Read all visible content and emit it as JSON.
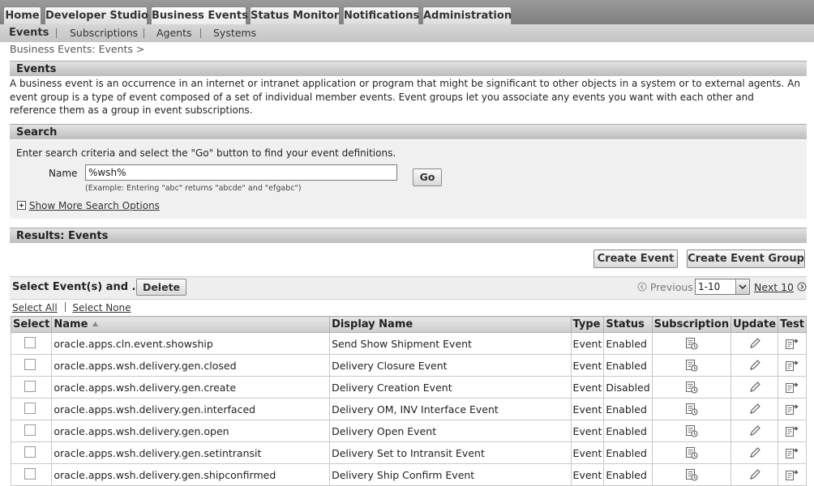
{
  "tabs": [
    {
      "label": "Home"
    },
    {
      "label": "Developer Studio"
    },
    {
      "label": "Business Events"
    },
    {
      "label": "Status Monitor"
    },
    {
      "label": "Notifications"
    },
    {
      "label": "Administration"
    }
  ],
  "subnav": [
    {
      "label": "Events"
    },
    {
      "label": "Subscriptions"
    },
    {
      "label": "Agents"
    },
    {
      "label": "Systems"
    }
  ],
  "breadcrumb": "Business Events: Events  >",
  "events_section": {
    "title": "Events",
    "description": "A business event is an occurrence in an internet or intranet application or program that might be significant to other objects in a system or to external agents. An event group is a type of event composed of a set of individual member events. Event groups let you associate any events you want with each other and reference them as a group in event subscriptions."
  },
  "search": {
    "title": "Search",
    "instructions": "Enter search criteria and select the \"Go\" button to find your event definitions.",
    "name_label": "Name",
    "name_value": "%wsh%",
    "example": "(Example: Entering \"abc\" returns \"abcde\" and \"efgabc\")",
    "go_label": "Go",
    "more_options_label": "Show More Search Options"
  },
  "results": {
    "title": "Results: Events",
    "create_event_label": "Create Event",
    "create_group_label": "Create Event Group",
    "select_label": "Select Event(s) and ...",
    "delete_label": "Delete",
    "previous_label": "Previous",
    "range_value": "1-10",
    "next_label": "Next 10",
    "select_all_label": "Select All",
    "select_none_label": "Select None",
    "columns": {
      "select": "Select",
      "name": "Name",
      "display_name": "Display Name",
      "type": "Type",
      "status": "Status",
      "subscription": "Subscription",
      "update": "Update",
      "test": "Test"
    },
    "rows": [
      {
        "name": "oracle.apps.cln.event.showship",
        "display_name": "Send Show Shipment Event",
        "type": "Event",
        "status": "Enabled"
      },
      {
        "name": "oracle.apps.wsh.delivery.gen.closed",
        "display_name": "Delivery Closure Event",
        "type": "Event",
        "status": "Enabled"
      },
      {
        "name": "oracle.apps.wsh.delivery.gen.create",
        "display_name": "Delivery Creation Event",
        "type": "Event",
        "status": "Disabled"
      },
      {
        "name": "oracle.apps.wsh.delivery.gen.interfaced",
        "display_name": "Delivery OM, INV Interface Event",
        "type": "Event",
        "status": "Enabled"
      },
      {
        "name": "oracle.apps.wsh.delivery.gen.open",
        "display_name": "Delivery Open Event",
        "type": "Event",
        "status": "Enabled"
      },
      {
        "name": "oracle.apps.wsh.delivery.gen.setintransit",
        "display_name": "Delivery Set to Intransit Event",
        "type": "Event",
        "status": "Enabled"
      },
      {
        "name": "oracle.apps.wsh.delivery.gen.shipconfirmed",
        "display_name": "Delivery Ship Confirm Event",
        "type": "Event",
        "status": "Enabled"
      }
    ]
  }
}
